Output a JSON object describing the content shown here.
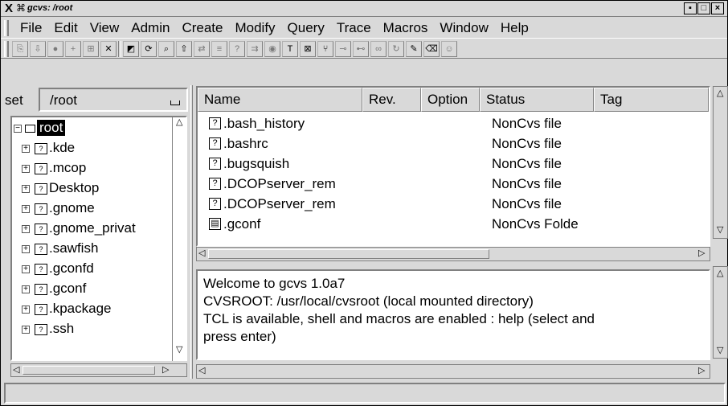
{
  "window": {
    "title": "gcvs: /root",
    "x_icon": "X",
    "app_icon": "⌘",
    "buttons": [
      "▪",
      "□",
      "×"
    ]
  },
  "menu": [
    "File",
    "Edit",
    "View",
    "Admin",
    "Create",
    "Modify",
    "Query",
    "Trace",
    "Macros",
    "Window",
    "Help"
  ],
  "toolbar_icons": [
    "checkout-icon",
    "update-icon",
    "commit-icon",
    "add-icon",
    "add-binary-icon",
    "remove-icon",
    "explore-icon",
    "diff-icon",
    "log-icon",
    "graph-icon",
    "status-icon",
    "tag-icon",
    "branch-icon",
    "release-icon",
    "edit-icon",
    "unedit-icon"
  ],
  "left": {
    "set_label": "set",
    "path": "/root",
    "tree": [
      {
        "label": "root",
        "expanded": true,
        "selected": true
      },
      {
        "label": ".kde"
      },
      {
        "label": ".mcop"
      },
      {
        "label": "Desktop"
      },
      {
        "label": ".gnome"
      },
      {
        "label": ".gnome_privat"
      },
      {
        "label": ".sawfish"
      },
      {
        "label": ".gconfd"
      },
      {
        "label": ".gconf"
      },
      {
        "label": ".kpackage"
      },
      {
        "label": ".ssh"
      }
    ]
  },
  "files": {
    "columns": [
      "Name",
      "Rev.",
      "Option",
      "Status",
      "Tag"
    ],
    "rows": [
      {
        "name": ".bash_history",
        "status": "NonCvs file",
        "icon": "unknown-file-icon"
      },
      {
        "name": ".bashrc",
        "status": "NonCvs file",
        "icon": "unknown-file-icon"
      },
      {
        "name": ".bugsquish",
        "status": "NonCvs file",
        "icon": "unknown-file-icon"
      },
      {
        "name": ".DCOPserver_rem",
        "status": "NonCvs file",
        "icon": "unknown-file-icon"
      },
      {
        "name": ".DCOPserver_rem",
        "status": "NonCvs file",
        "icon": "unknown-file-icon"
      },
      {
        "name": ".gconf",
        "status": "NonCvs Folde",
        "icon": "folder-icon"
      }
    ]
  },
  "log": {
    "lines": [
      "Welcome to gcvs 1.0a7",
      "CVSROOT: /usr/local/cvsroot (local mounted directory)",
      "TCL is available, shell and macros are enabled : help (select and",
      "press enter)"
    ]
  }
}
